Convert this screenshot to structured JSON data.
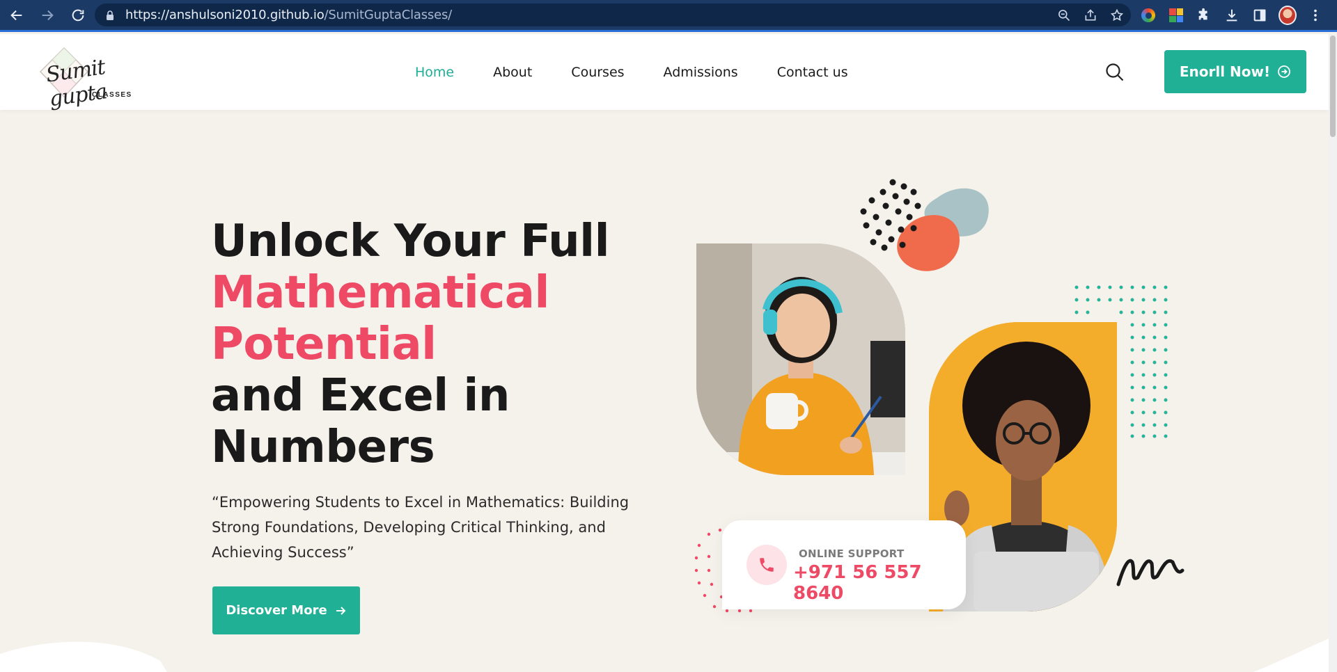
{
  "browser": {
    "url_domain": "https://anshulsoni2010.github.io",
    "url_path": "/SumitGuptaClasses/"
  },
  "site": {
    "logo_script": "Sumit gupta",
    "logo_sub": "CLASSES",
    "nav": [
      {
        "label": "Home",
        "active": true
      },
      {
        "label": "About",
        "active": false
      },
      {
        "label": "Courses",
        "active": false
      },
      {
        "label": "Admissions",
        "active": false
      },
      {
        "label": "Contact us",
        "active": false
      }
    ],
    "enroll_label": "Enorll Now!",
    "accent_color": "#1fb096",
    "highlight_color": "#ee4a66"
  },
  "hero": {
    "title_line1": "Unlock Your Full",
    "title_accent1": "Mathematical",
    "title_accent2": "Potential",
    "title_line4": "and Excel in",
    "title_line5": "Numbers",
    "description": "“Empowering Students to Excel in Mathematics: Building Strong Foundations, Developing Critical Thinking, and Achieving Success”",
    "discover_label": "Discover More"
  },
  "support": {
    "label": "ONLINE SUPPORT",
    "number": "+971 56 557 8640"
  }
}
